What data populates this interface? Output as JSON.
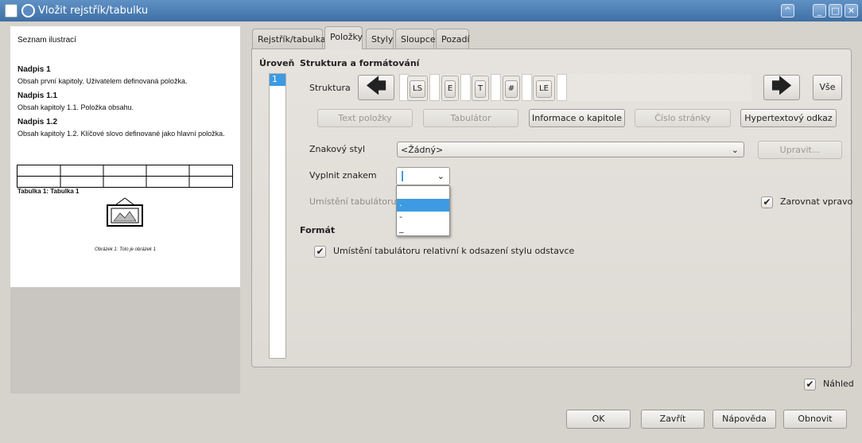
{
  "window": {
    "title": "Vložit rejstřík/tabulku"
  },
  "preview": {
    "title": "Seznam ilustrací",
    "entries": [
      {
        "heading": "Nadpis 1",
        "text": "Obsah první kapitoly. Uživatelem definovaná položka."
      },
      {
        "heading": "Nadpis 1.1",
        "text": "Obsah kapitoly 1.1. Položka obsahu."
      },
      {
        "heading": "Nadpis 1.2",
        "text": "Obsah kapitoly 1.2. Klíčové slovo definované jako hlavní položka."
      }
    ],
    "table_caption": "Tabulka 1: Tabulka 1",
    "image_caption": "Obrázek 1: Toto je obrázek 1"
  },
  "tabs": [
    "Rejstřík/tabulka",
    "Položky",
    "Styly",
    "Sloupce",
    "Pozadí"
  ],
  "level": {
    "label": "Úroveň",
    "items": [
      "1"
    ],
    "selected": "1"
  },
  "structure": {
    "section_label": "Struktura a formátování",
    "structure_label": "Struktura",
    "tokens": [
      "LS",
      "E",
      "T",
      "#",
      "LE"
    ],
    "all_button": "Vše",
    "buttons": [
      "Text položky",
      "Tabulátor",
      "Informace o kapitole",
      "Číslo stránky",
      "Hypertextový odkaz"
    ]
  },
  "char_style": {
    "label": "Znakový styl",
    "value": "<Žádný>",
    "edit_button": "Upravit..."
  },
  "fill_char": {
    "label": "Vyplnit znakem",
    "value": "",
    "options": [
      "",
      ".",
      "-",
      "_"
    ],
    "selected_index": 1
  },
  "tab_position": {
    "label": "Umístění tabulátoru"
  },
  "align_right": {
    "label": "Zarovnat vpravo",
    "checked": true
  },
  "format": {
    "label": "Formát",
    "relative_label": "Umístění tabulátoru relativní k odsazení stylu odstavce",
    "checked": true
  },
  "preview_check": {
    "label": "Náhled",
    "checked": true
  },
  "footer": {
    "ok": "OK",
    "close": "Zavřít",
    "help": "Nápověda",
    "reset": "Obnovit"
  },
  "colors": {
    "selection": "#3d9be3",
    "titlebar": "#4a7bb0"
  }
}
